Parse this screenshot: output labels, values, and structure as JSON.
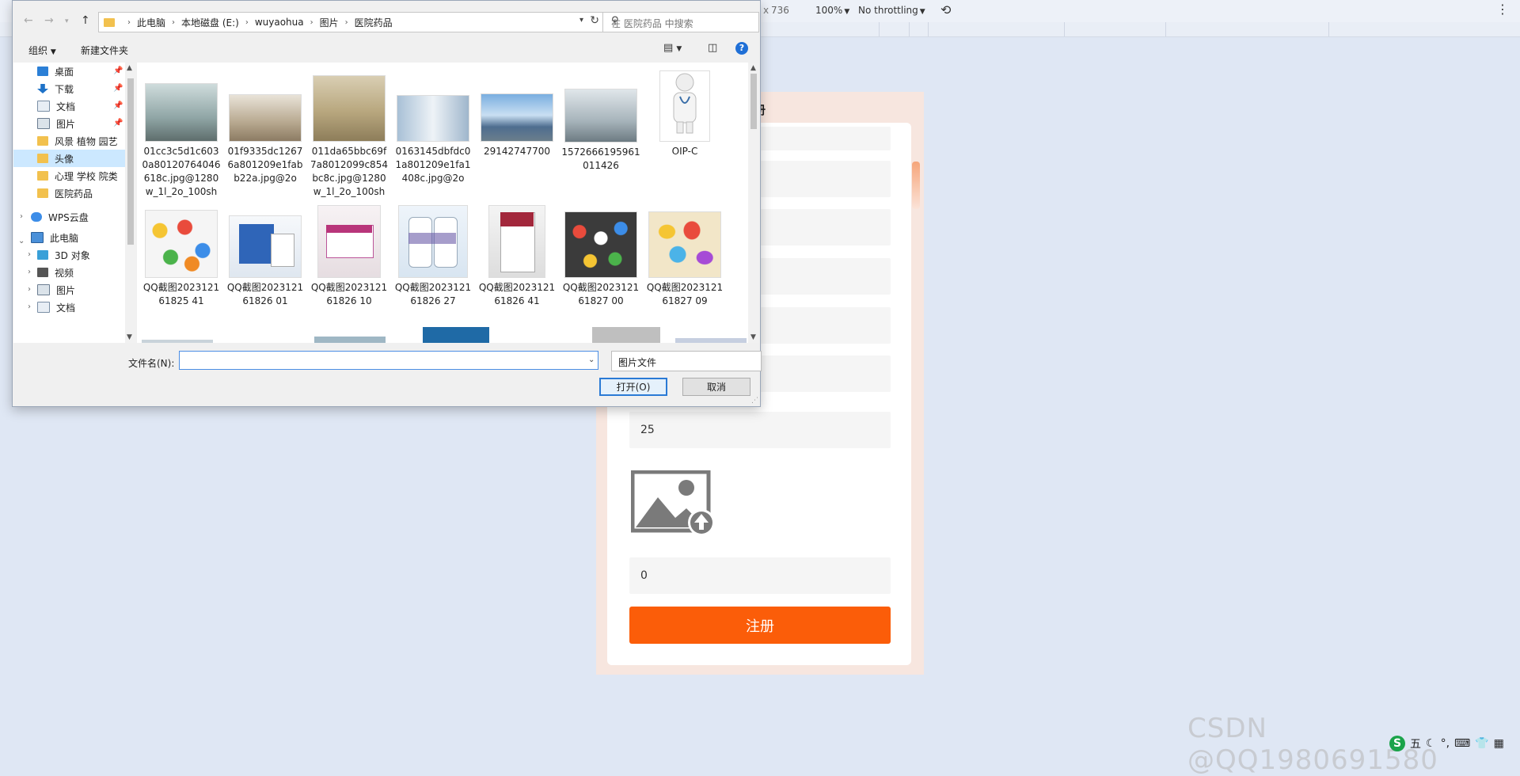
{
  "devtools": {
    "dimension_value": "736",
    "zoom": "100%",
    "throttling": "No throttling"
  },
  "dialog": {
    "breadcrumbs": [
      "此电脑",
      "本地磁盘 (E:)",
      "wuyaohua",
      "图片",
      "医院药品"
    ],
    "search_placeholder": "在 医院药品 中搜索",
    "toolbar": {
      "organize": "组织",
      "new_folder": "新建文件夹"
    },
    "nav_items": [
      {
        "label": "桌面",
        "icon": "desktop-icon",
        "pinned": true
      },
      {
        "label": "下载",
        "icon": "download-icon",
        "pinned": true
      },
      {
        "label": "文档",
        "icon": "document-icon",
        "pinned": true
      },
      {
        "label": "图片",
        "icon": "pictures-icon",
        "pinned": true
      },
      {
        "label": "风景 植物 园艺",
        "icon": "folder-icon"
      },
      {
        "label": "头像",
        "icon": "folder-icon",
        "selected": true
      },
      {
        "label": "心理 学校 院类",
        "icon": "folder-icon"
      },
      {
        "label": "医院药品",
        "icon": "folder-icon"
      },
      {
        "label": "WPS云盘",
        "icon": "cloud-icon"
      },
      {
        "label": "此电脑",
        "icon": "computer-icon"
      },
      {
        "label": "3D 对象",
        "icon": "3d-objects-icon"
      },
      {
        "label": "视频",
        "icon": "video-icon"
      },
      {
        "label": "图片",
        "icon": "pictures-icon"
      },
      {
        "label": "文档",
        "icon": "document-icon"
      }
    ],
    "files": [
      {
        "name": "01cc3c5d1c6030a80120764046618c.jpg@1280w_1l_2o_100sh",
        "thumb": "hospital-lobby"
      },
      {
        "name": "01f9335dc12676a801209e1fabb22a.jpg@2o",
        "thumb": "hospital-reception"
      },
      {
        "name": "011da65bbc69f7a8012099c854bc8c.jpg@1280w_1l_2o_100sh",
        "thumb": "hospital-corridor"
      },
      {
        "name": "0163145dbfdc01a801209e1fa1408c.jpg@2o",
        "thumb": "hospital-hallway"
      },
      {
        "name": "29142747700",
        "thumb": "hospital-building"
      },
      {
        "name": "1572666195961011426",
        "thumb": "hospital-ward"
      },
      {
        "name": "OIP-C",
        "thumb": "doctor-figure"
      },
      {
        "name": "QQ截图202312161825 41",
        "thumb": "pills"
      },
      {
        "name": "QQ截图202312161826 01",
        "thumb": "medicine-box"
      },
      {
        "name": "QQ截图202312161826 10",
        "thumb": "medicine-box"
      },
      {
        "name": "QQ截图202312161826 27",
        "thumb": "medicine-bottles"
      },
      {
        "name": "QQ截图202312161826 41",
        "thumb": "medicine-box"
      },
      {
        "name": "QQ截图202312161827 00",
        "thumb": "pills"
      },
      {
        "name": "QQ截图202312161827 09",
        "thumb": "pills"
      }
    ],
    "filename_label": "文件名(N):",
    "filename_value": "",
    "filter_value": "图片文件",
    "open_button": "打开(O)",
    "cancel_button": "取消"
  },
  "form": {
    "title_partial": "册",
    "age_value": "25",
    "number_value": "0",
    "submit_label": "注册",
    "accent_color": "#fb5d09"
  },
  "watermark": "CSDN @QQ1980691580",
  "taskbar": {
    "ime": "五"
  }
}
